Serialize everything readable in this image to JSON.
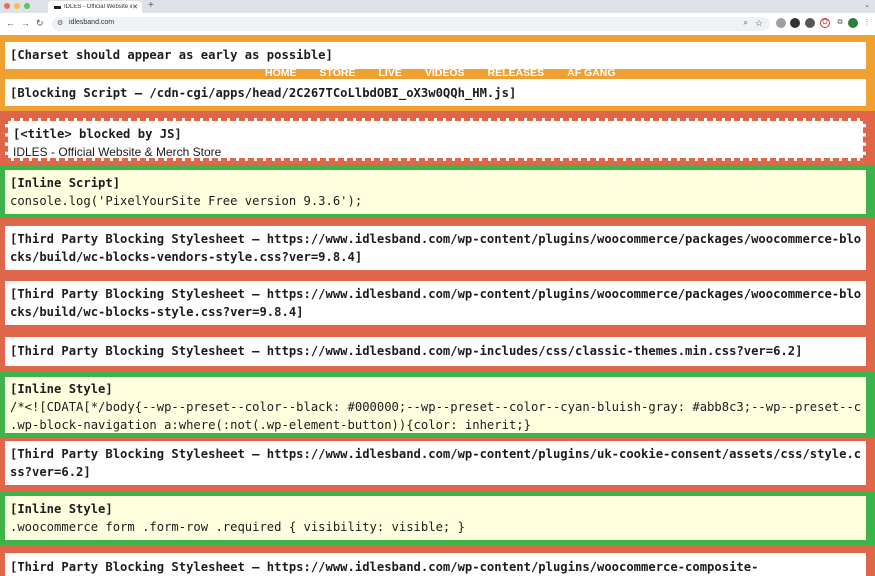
{
  "browser": {
    "tab_title": "IDLES - Official Website & Me",
    "new_tab": "+",
    "url": "idlesband.com"
  },
  "nav": {
    "items": [
      "HOME",
      "STORE",
      "LIVE",
      "VIDEOS",
      "RELEASES",
      "AF GANG"
    ]
  },
  "blocks": [
    {
      "label": "[Charset should appear as early as possible]",
      "text": ""
    },
    {
      "label": "[Blocking Script – /cdn-cgi/apps/head/2C267TCoLlbdOBI_oX3w0QQh_HM.js]",
      "text": ""
    },
    {
      "label": "[<title> blocked by JS]",
      "text": "IDLES - Official Website & Merch Store"
    },
    {
      "label": "[Inline Script]",
      "text": "console.log('PixelYourSite Free version 9.3.6');"
    },
    {
      "label": "[Third Party Blocking Stylesheet – https://www.idlesband.com/wp-content/plugins/woocommerce/packages/woocommerce-blocks/build/wc-blocks-vendors-style.css?ver=9.8.4]",
      "text": ""
    },
    {
      "label": "[Third Party Blocking Stylesheet – https://www.idlesband.com/wp-content/plugins/woocommerce/packages/woocommerce-blocks/build/wc-blocks-style.css?ver=9.8.4]",
      "text": ""
    },
    {
      "label": "[Third Party Blocking Stylesheet – https://www.idlesband.com/wp-includes/css/classic-themes.min.css?ver=6.2]",
      "text": ""
    },
    {
      "label": "[Inline Style]",
      "text": "/*<![CDATA[*/body{--wp--preset--color--black: #000000;--wp--preset--color--cyan-bluish-gray: #abb8c3;--wp--preset--c",
      "text2": ".wp-block-navigation a:where(:not(.wp-element-button)){color: inherit;}"
    },
    {
      "label": "[Third Party Blocking Stylesheet – https://www.idlesband.com/wp-content/plugins/uk-cookie-consent/assets/css/style.css?ver=6.2]",
      "text": ""
    },
    {
      "label": "[Inline Style]",
      "text": ".woocommerce form .form-row .required { visibility: visible; }"
    },
    {
      "label": "[Third Party Blocking Stylesheet – https://www.idlesband.com/wp-content/plugins/woocommerce-composite-",
      "text": ""
    }
  ]
}
